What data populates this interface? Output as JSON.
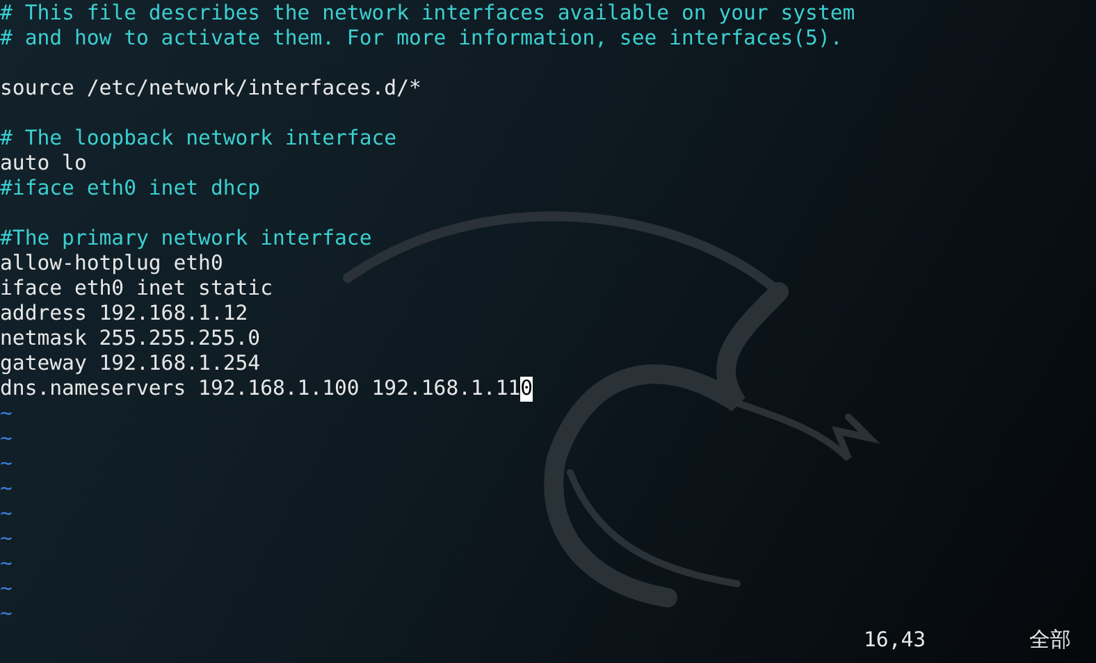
{
  "lines": [
    {
      "kind": "comment",
      "text": "# This file describes the network interfaces available on your system"
    },
    {
      "kind": "comment",
      "text": "# and how to activate them. For more information, see interfaces(5)."
    },
    {
      "kind": "blank"
    },
    {
      "kind": "code",
      "text": "source /etc/network/interfaces.d/*"
    },
    {
      "kind": "blank"
    },
    {
      "kind": "comment",
      "text": "# The loopback network interface"
    },
    {
      "kind": "code",
      "text": "auto lo"
    },
    {
      "kind": "comment",
      "text": "#iface eth0 inet dhcp"
    },
    {
      "kind": "blank"
    },
    {
      "kind": "comment",
      "text": "#The primary network interface"
    },
    {
      "kind": "code",
      "text": "allow-hotplug eth0"
    },
    {
      "kind": "code",
      "text": "iface eth0 inet static"
    },
    {
      "kind": "code",
      "text": "address 192.168.1.12"
    },
    {
      "kind": "code",
      "text": "netmask 255.255.255.0"
    },
    {
      "kind": "code",
      "text": "gateway 192.168.1.254"
    },
    {
      "kind": "code",
      "text": "dns.nameservers 192.168.1.100 192.168.1.11",
      "cursor_char": "0"
    }
  ],
  "empty_rows": [
    "~",
    "~",
    "~",
    "~",
    "~",
    "~",
    "~",
    "~",
    "~"
  ],
  "status": {
    "ruler": "16,43",
    "position": "全部"
  }
}
